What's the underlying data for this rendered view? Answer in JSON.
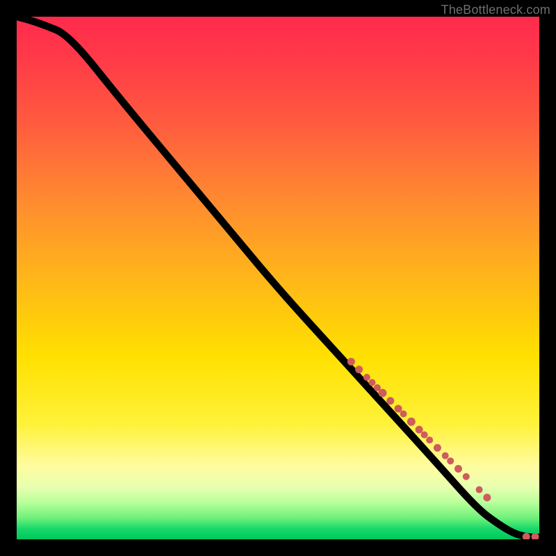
{
  "watermark": "TheBottleneck.com",
  "chart_data": {
    "type": "line",
    "title": "",
    "xlabel": "",
    "ylabel": "",
    "xlim": [
      0,
      100
    ],
    "ylim": [
      0,
      100
    ],
    "grid": false,
    "legend": false,
    "curve": {
      "x": [
        0,
        2,
        5,
        10,
        20,
        30,
        40,
        50,
        60,
        70,
        80,
        88,
        92,
        95,
        97,
        98.5,
        100
      ],
      "y": [
        100,
        99.5,
        98.5,
        96.5,
        84,
        72,
        60,
        48,
        37,
        26,
        15,
        6,
        3,
        1.2,
        0.6,
        0.4,
        0.4
      ]
    },
    "markers": {
      "comment": "cluster of points lying on the curve in the lower-right quadrant, plus two near-baseline points at far right",
      "x": [
        64,
        65.5,
        67,
        68,
        69,
        70,
        71.5,
        73,
        74,
        75.5,
        77,
        78,
        79,
        80.5,
        82,
        83,
        84.5,
        86,
        88.5,
        90,
        97.5,
        99.2
      ],
      "y": [
        34,
        32.5,
        31,
        30,
        29,
        28,
        26.5,
        25,
        24,
        22.5,
        21,
        20,
        19,
        17.5,
        16,
        15,
        13.5,
        12,
        9.5,
        8,
        0.5,
        0.5
      ],
      "r": [
        5.5,
        5.5,
        5.0,
        5.0,
        5.0,
        6.0,
        5.5,
        5.5,
        5.0,
        6.0,
        5.5,
        5.0,
        5.0,
        5.5,
        5.0,
        5.0,
        5.5,
        5.0,
        5.0,
        5.5,
        5.5,
        5.5
      ]
    },
    "gradient_colors": {
      "top": "#ff2a4d",
      "mid": "#ffe000",
      "bottom": "#00c85b"
    }
  }
}
